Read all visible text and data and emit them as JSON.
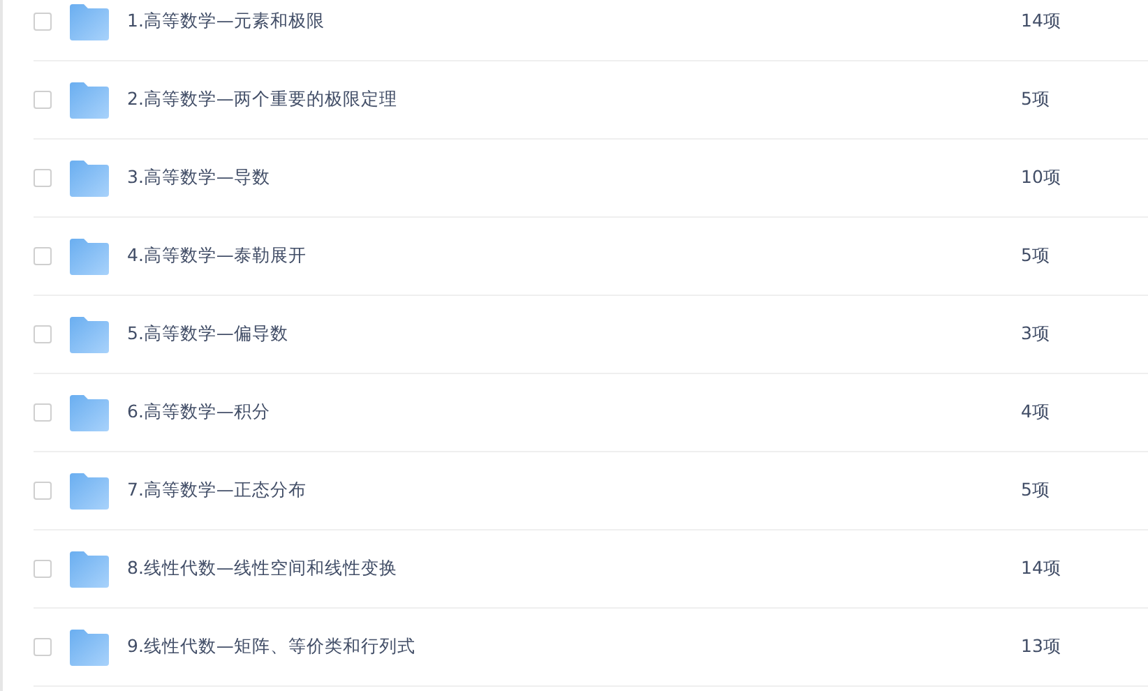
{
  "files": [
    {
      "name": "1.高等数学—元素和极限",
      "count": "14项",
      "checked": false
    },
    {
      "name": "2.高等数学—两个重要的极限定理",
      "count": "5项",
      "checked": false
    },
    {
      "name": "3.高等数学—导数",
      "count": "10项",
      "checked": false
    },
    {
      "name": "4.高等数学—泰勒展开",
      "count": "5项",
      "checked": false
    },
    {
      "name": "5.高等数学—偏导数",
      "count": "3项",
      "checked": false
    },
    {
      "name": "6.高等数学—积分",
      "count": "4项",
      "checked": false
    },
    {
      "name": "7.高等数学—正态分布",
      "count": "5项",
      "checked": false
    },
    {
      "name": "8.线性代数—线性空间和线性变换",
      "count": "14项",
      "checked": false
    },
    {
      "name": "9.线性代数—矩阵、等价类和行列式",
      "count": "13项",
      "checked": false
    }
  ]
}
